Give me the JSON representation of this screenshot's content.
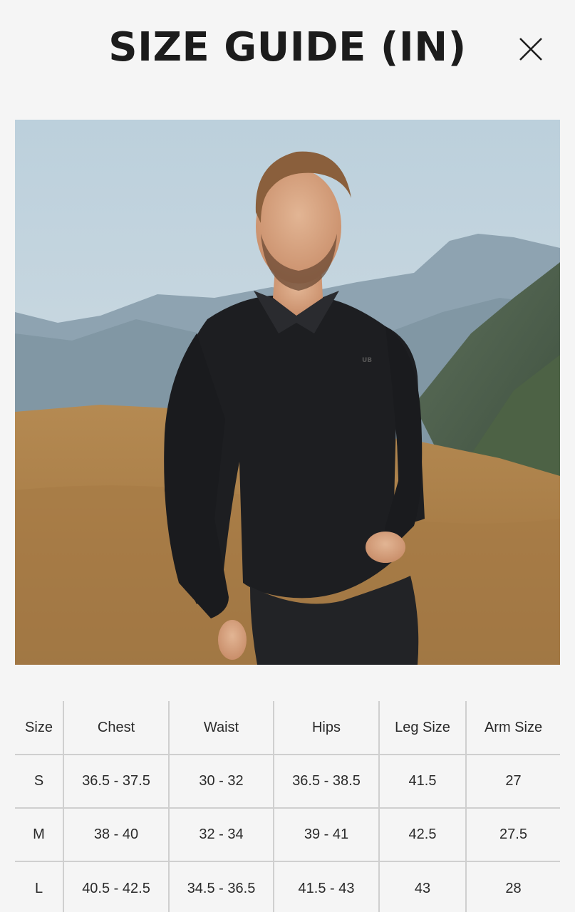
{
  "header": {
    "title": "SIZE GUIDE (IN)",
    "close_icon": "close-icon"
  },
  "photo": {
    "alt": "Model wearing black long-sleeve polo on a mountain hillside",
    "shirt_logo": "UB"
  },
  "size_table": {
    "headers": [
      "Size",
      "Chest",
      "Waist",
      "Hips",
      "Leg Size",
      "Arm Size"
    ],
    "rows": [
      [
        "S",
        "36.5 - 37.5",
        "30 - 32",
        "36.5 - 38.5",
        "41.5",
        "27"
      ],
      [
        "M",
        "38 - 40",
        "32 - 34",
        "39 - 41",
        "42.5",
        "27.5"
      ],
      [
        "L",
        "40.5 - 42.5",
        "34.5 - 36.5",
        "41.5 - 43",
        "43",
        "28"
      ]
    ]
  },
  "colors": {
    "background": "#f5f5f5",
    "text": "#1f1f1f",
    "table_border": "#cfcfcf"
  }
}
